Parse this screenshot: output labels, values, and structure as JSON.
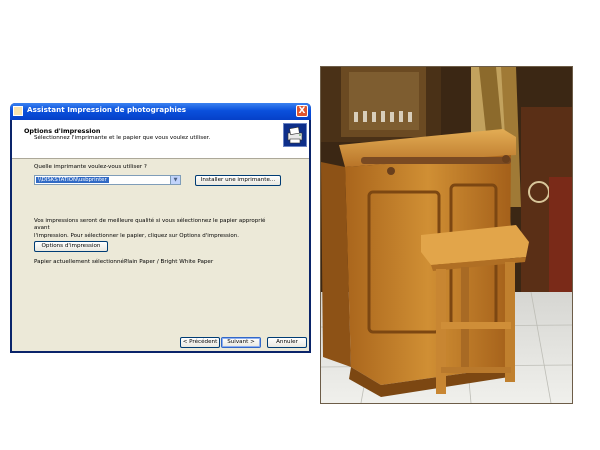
{
  "window": {
    "title": "Assistant Impression de photographies",
    "close_glyph": "X"
  },
  "header": {
    "title": "Options d'impression",
    "subtitle": "Sélectionnez l'imprimante et le papier que vous voulez utiliser.",
    "icon": "printer-icon"
  },
  "printer": {
    "question": "Quelle imprimante voulez-vous utiliser ?",
    "selected": "\\\\DISKSTATION\\usbprinter",
    "install_label": "Installer une imprimante..."
  },
  "paper": {
    "info_line1": "Vos impressions seront de meilleure qualité si vous sélectionnez le papier approprié avant",
    "info_line2": "l'impression. Pour sélectionner le papier, cliquez sur Options d'impression.",
    "options_label": "Options d'impression",
    "current_label": "Papier actuellement sélectionné :",
    "current_value": "Plain Paper / Bright White Paper"
  },
  "footer": {
    "back_label": "< Précédent",
    "next_label": "Suivant >",
    "cancel_label": "Annuler"
  },
  "photo": {
    "description_icon": "photo-image"
  }
}
